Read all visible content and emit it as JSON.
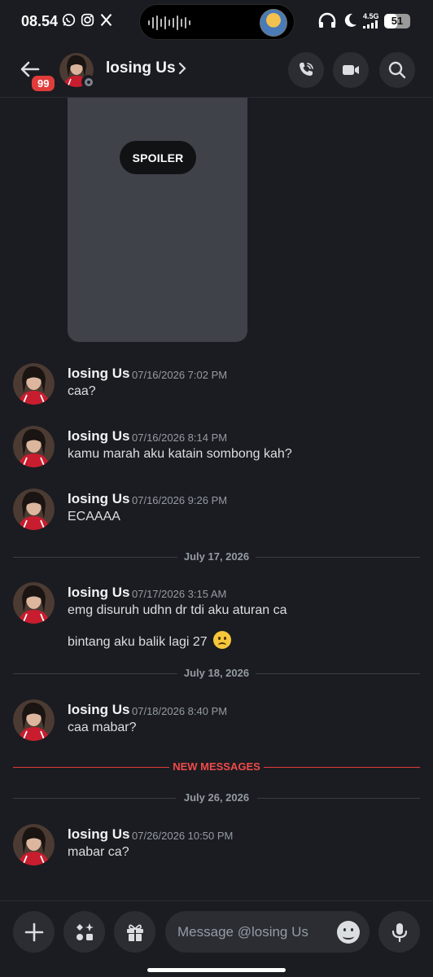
{
  "status_bar": {
    "time": "08.54",
    "network": "4.5G",
    "battery": "51",
    "battery_level": 0.51
  },
  "header": {
    "unread_badge": "99",
    "title": "losing Us"
  },
  "spoiler": {
    "label": "SPOILER"
  },
  "messages": [
    {
      "author": "losing Us",
      "time": "07/16/2026 7:02 PM",
      "text": "caa?"
    },
    {
      "author": "losing Us",
      "time": "07/16/2026 8:14 PM",
      "text": "kamu marah aku katain sombong kah?"
    },
    {
      "author": "losing Us",
      "time": "07/16/2026 9:26 PM",
      "text": "ECAAAA"
    },
    {
      "author": "losing Us",
      "time": "07/17/2026 3:15 AM",
      "text": "emg disuruh udhn dr tdi aku aturan ca",
      "text2": "bintang aku balik lagi 27"
    },
    {
      "author": "losing Us",
      "time": "07/18/2026 8:40 PM",
      "text": "caa mabar?"
    },
    {
      "author": "losing Us",
      "time": "07/26/2026 10:50 PM",
      "text": "mabar ca?"
    }
  ],
  "dividers": {
    "d1": "July 17, 2026",
    "d2": "July 18, 2026",
    "new": "NEW MESSAGES",
    "d3": "July 26, 2026"
  },
  "composer": {
    "placeholder": "Message @losing Us"
  },
  "colors": {
    "background": "#1b1c21",
    "surface": "#2b2d33",
    "badge_red": "#e03c3c",
    "new_messages_red": "#f04a4a",
    "muted_text": "#949ba4"
  }
}
